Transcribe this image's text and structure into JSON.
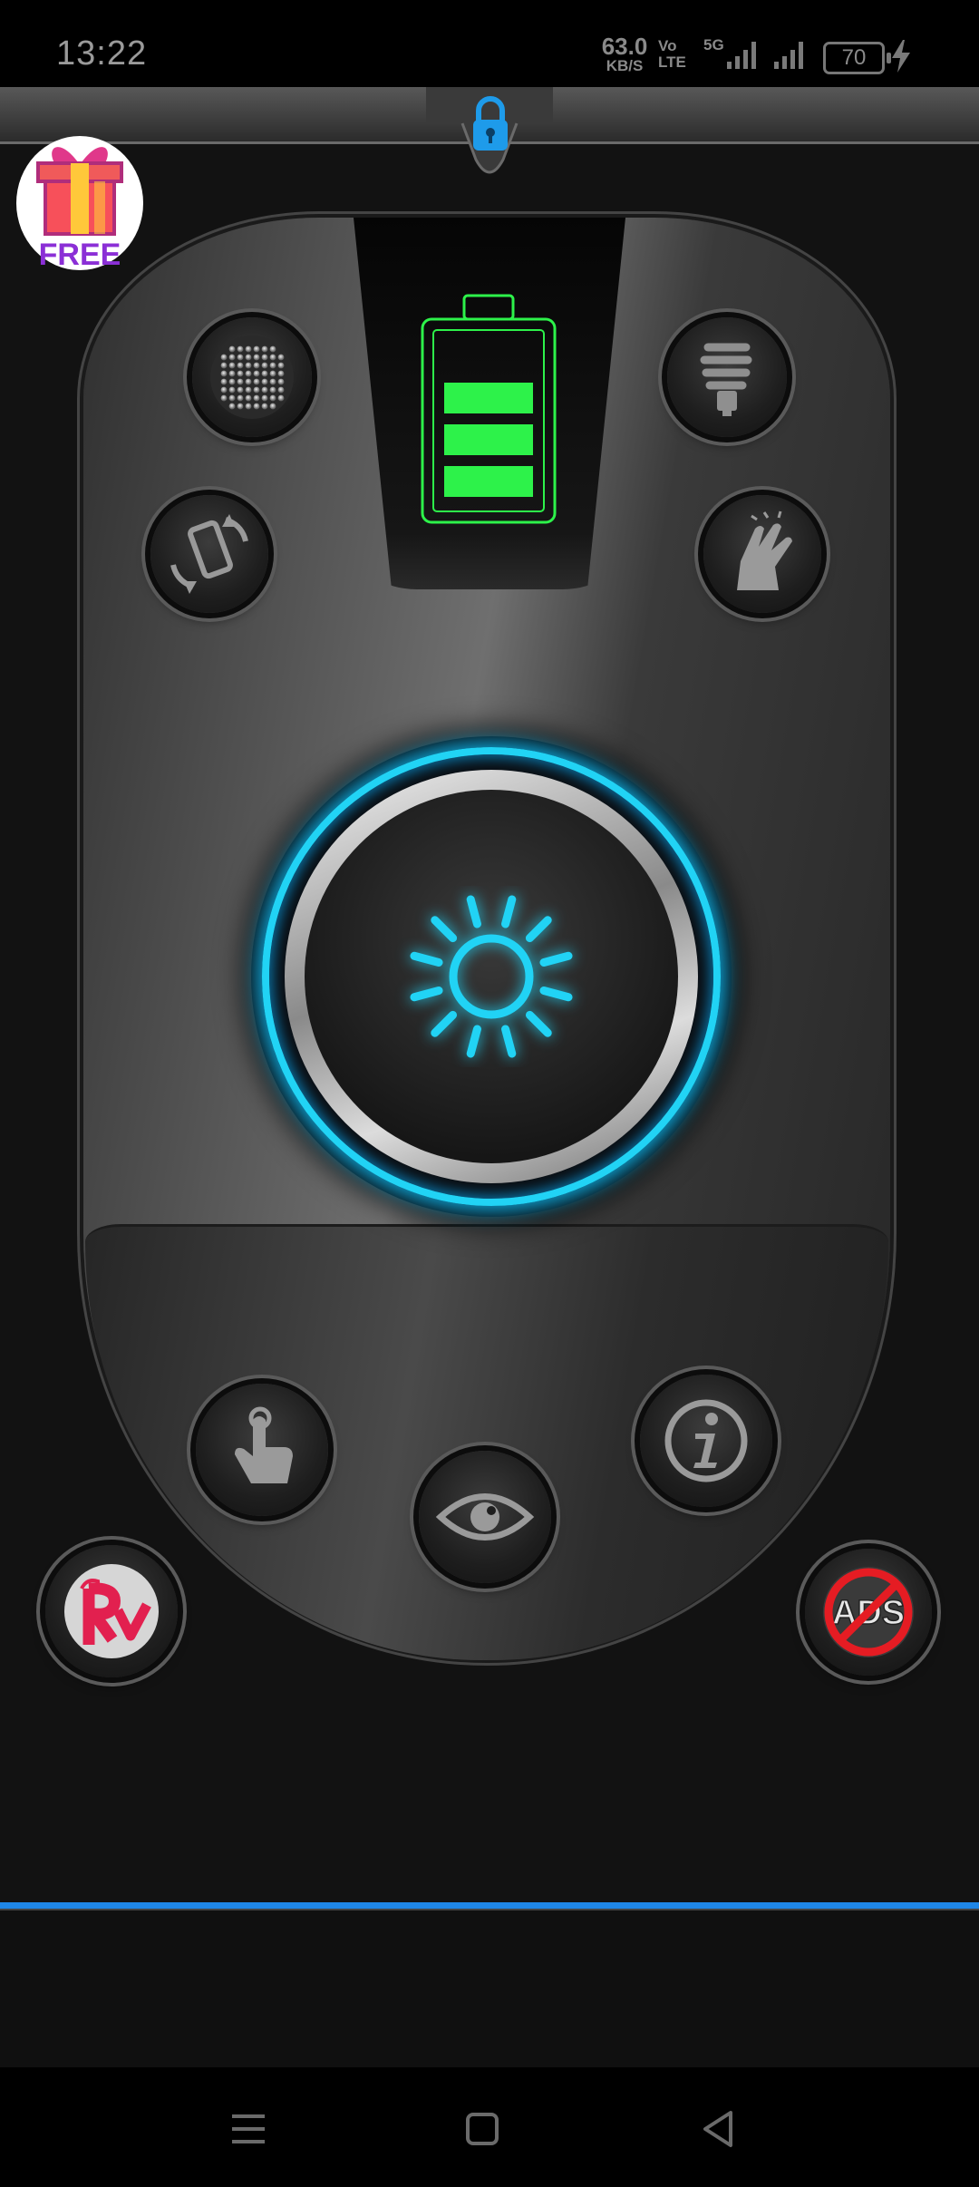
{
  "status_bar": {
    "time": "13:22",
    "net_speed_value": "63.0",
    "net_speed_unit": "KB/S",
    "volte_line1": "Vo",
    "volte_line2": "LTE",
    "network_type": "5G",
    "battery_level": "70"
  },
  "lock": {
    "icon": "lock-icon",
    "color": "#1e9bea"
  },
  "gift": {
    "label": "FREE",
    "icon": "gift-icon"
  },
  "battery_indicator": {
    "charge_fraction": 0.75,
    "color": "#2df24a"
  },
  "buttons": {
    "disco": "disco-ball-icon",
    "bulb": "light-bulb-icon",
    "shake": "shake-phone-icon",
    "clap": "clap-hands-icon",
    "power": "sun-icon",
    "touch": "touch-hand-icon",
    "info": "info-icon",
    "eye": "eye-icon"
  },
  "no_ads_label": "ADS",
  "logo_text": "Rv",
  "accent_color": "#21d3f5"
}
